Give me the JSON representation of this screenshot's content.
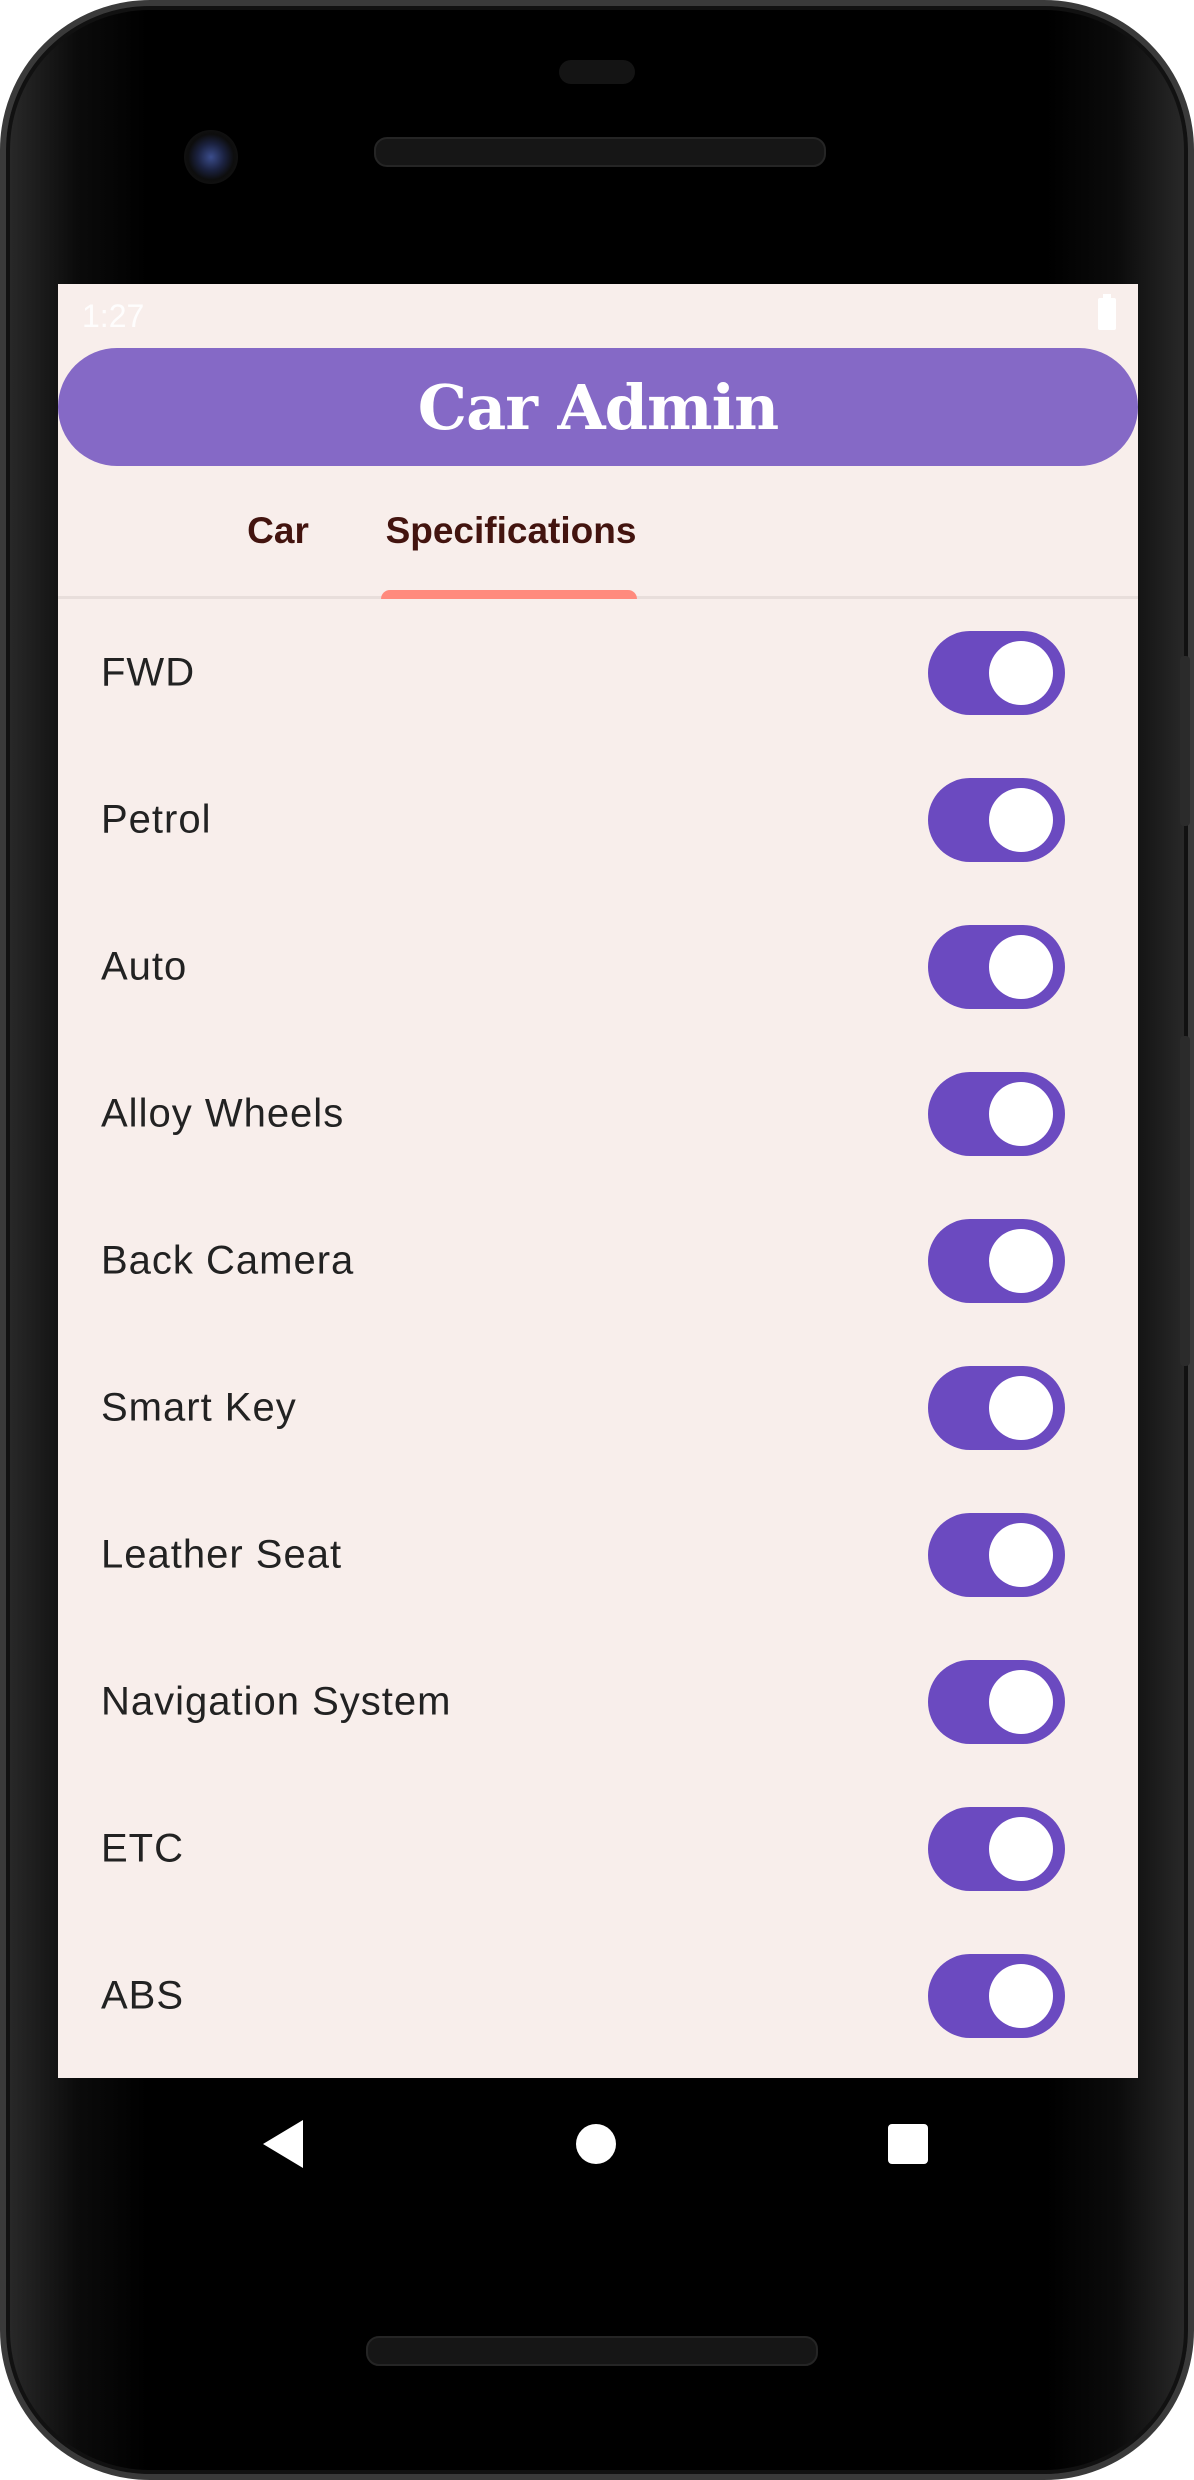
{
  "status_bar": {
    "time": "1:27",
    "battery": "battery-icon"
  },
  "app_bar": {
    "title": "Car Admin"
  },
  "tabs": [
    {
      "label": "Car",
      "selected": false
    },
    {
      "label": "Specifications",
      "selected": true
    }
  ],
  "specifications": [
    {
      "label": "FWD",
      "enabled": true
    },
    {
      "label": "Petrol",
      "enabled": true
    },
    {
      "label": "Auto",
      "enabled": true
    },
    {
      "label": "Alloy Wheels",
      "enabled": true
    },
    {
      "label": "Back Camera",
      "enabled": true
    },
    {
      "label": "Smart Key",
      "enabled": true
    },
    {
      "label": "Leather Seat",
      "enabled": true
    },
    {
      "label": "Navigation System",
      "enabled": true
    },
    {
      "label": "ETC",
      "enabled": true
    },
    {
      "label": "ABS",
      "enabled": true
    }
  ],
  "nav_bar": {
    "icons": [
      "back-icon",
      "home-icon",
      "recents-icon"
    ]
  },
  "colors": {
    "app_bar": "#8569c6",
    "toggle_on": "#6b4ac0",
    "tab_indicator": "#ff8a7d",
    "background": "#f8eeeb",
    "tab_text": "#43140f"
  }
}
